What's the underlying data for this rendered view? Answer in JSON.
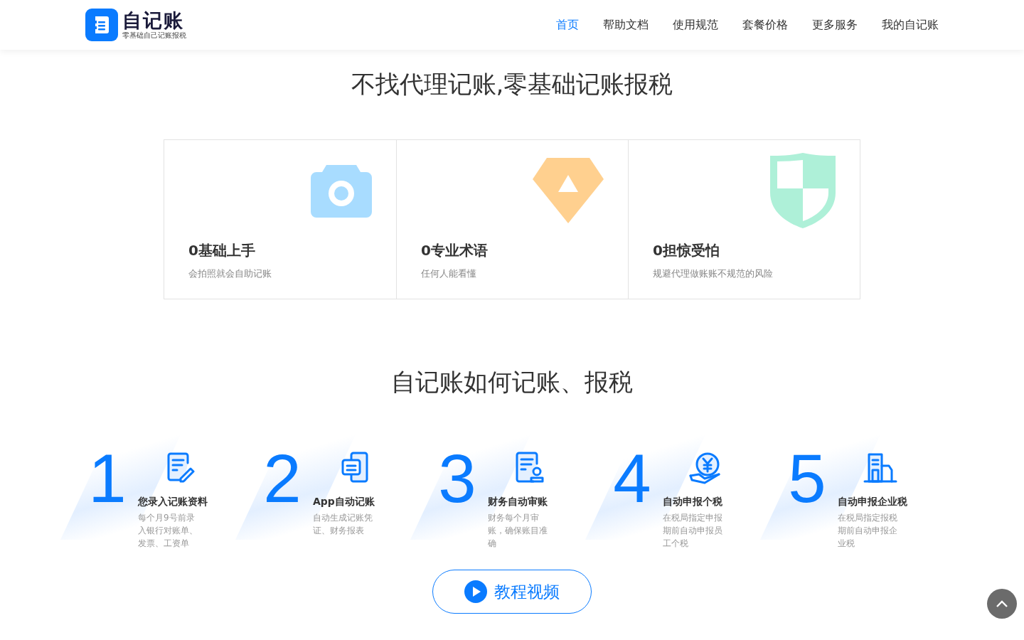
{
  "header": {
    "logo": {
      "name": "自记账",
      "tagline": "零基础自己记账报税"
    },
    "nav": [
      {
        "label": "首页",
        "selected": true
      },
      {
        "label": "帮助文档",
        "selected": false
      },
      {
        "label": "使用规范",
        "selected": false
      },
      {
        "label": "套餐价格",
        "selected": false
      },
      {
        "label": "更多服务",
        "selected": false
      },
      {
        "label": "我的自记账",
        "selected": false
      }
    ]
  },
  "features": {
    "title": "不找代理记账,零基础记账报税",
    "cards": [
      {
        "kind": "camera",
        "title": "0基础上手",
        "desc": "会拍照就会自助记账"
      },
      {
        "kind": "diamond",
        "title": "0专业术语",
        "desc": "任何人能看懂"
      },
      {
        "kind": "shield",
        "title": "0担惊受怕",
        "desc": "规避代理做账账不规范的风险"
      }
    ]
  },
  "steps": {
    "title": "自记账如何记账、报税",
    "items": [
      {
        "kind": "edit",
        "number": "1",
        "title": "您录入记账资料",
        "desc": "每个月9号前录入银行对账单、发票、工资单"
      },
      {
        "kind": "docs",
        "number": "2",
        "title": "App自动记账",
        "desc": "自动生成记账凭证、财务报表"
      },
      {
        "kind": "stamp",
        "number": "3",
        "title": "财务自动审账",
        "desc": "财务每个月审账，确保账目准确"
      },
      {
        "kind": "coin",
        "number": "4",
        "title": "自动申报个税",
        "desc": "在税局指定申报期前自动申报员工个税"
      },
      {
        "kind": "building",
        "number": "5",
        "title": "自动申报企业税",
        "desc": "在税局指定报税期前自动申报企业税"
      }
    ],
    "video_button": "教程视频"
  }
}
